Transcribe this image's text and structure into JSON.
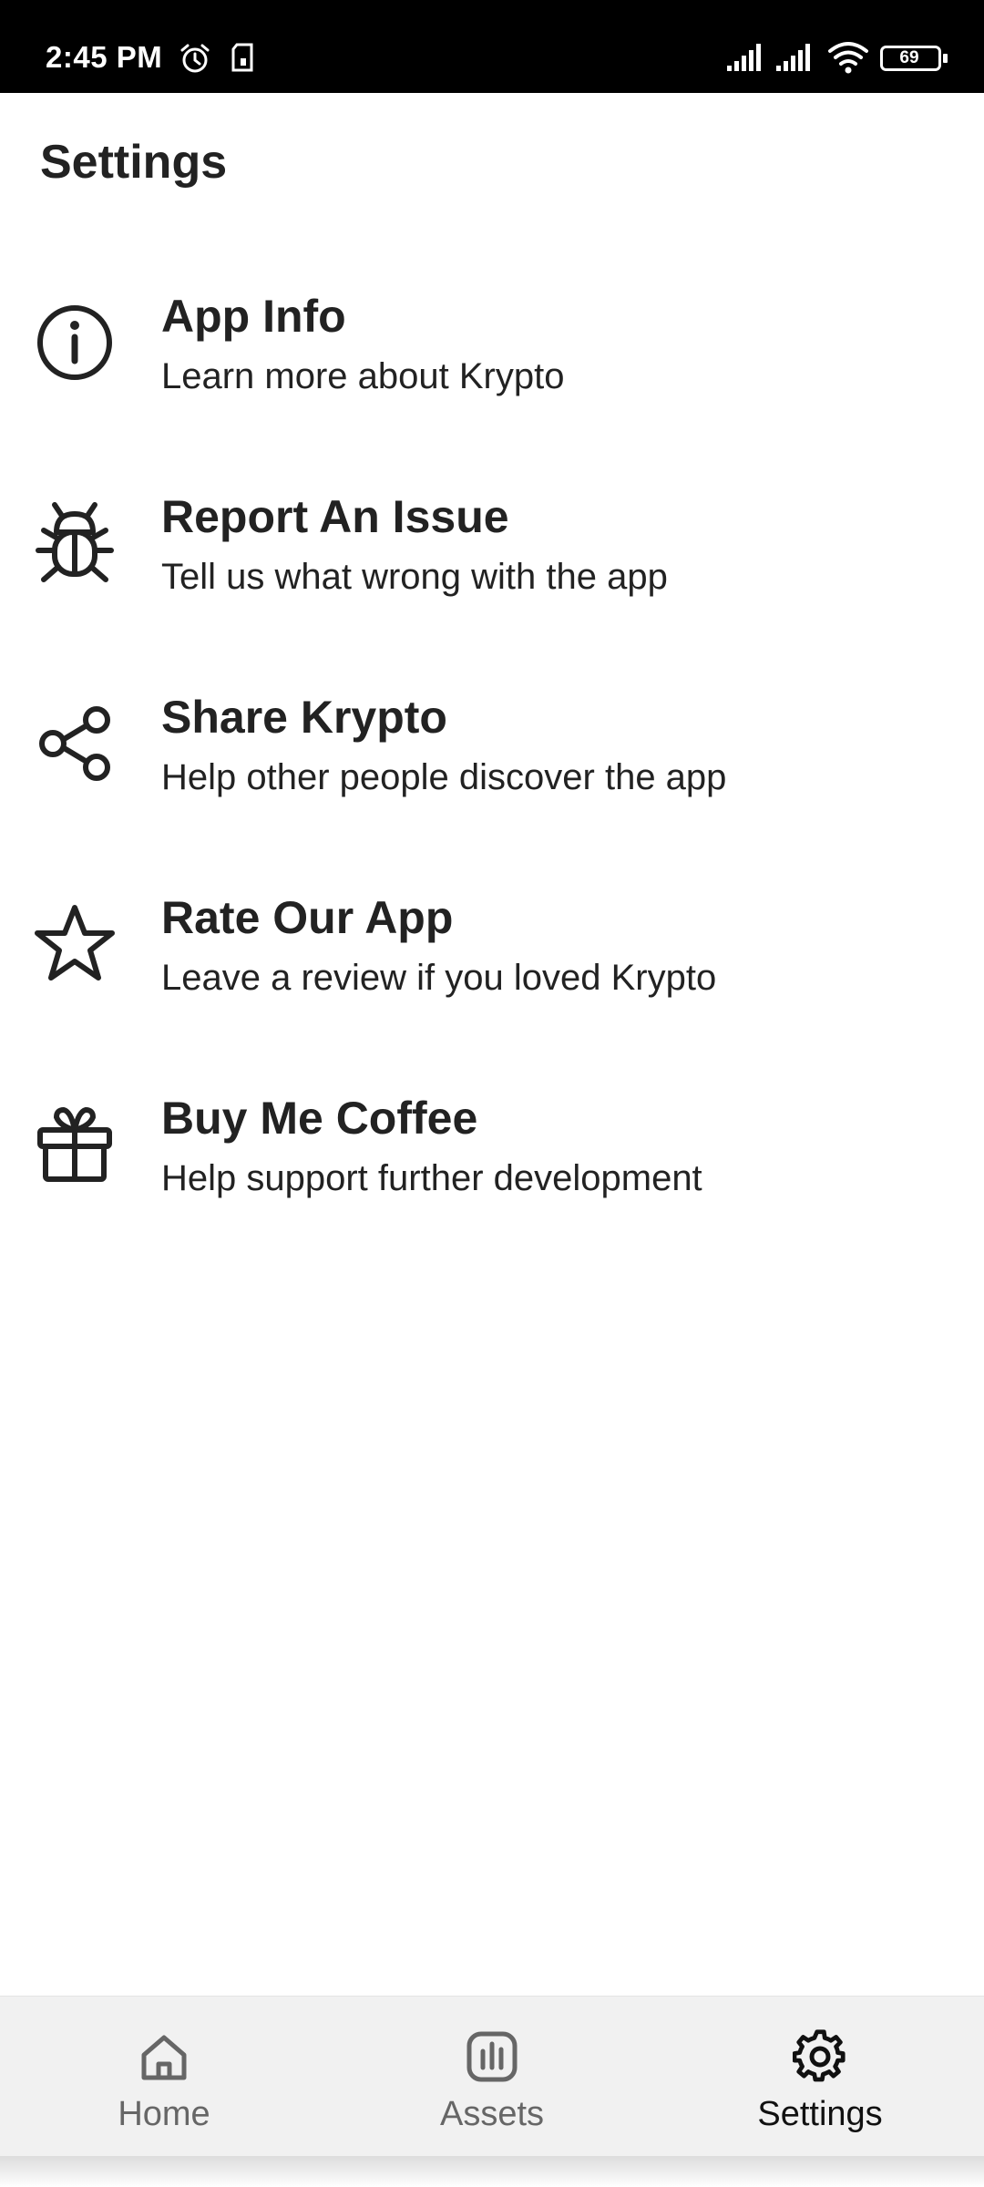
{
  "status_bar": {
    "time": "2:45 PM",
    "battery": "69",
    "icons": [
      "alarm-icon",
      "sd-card-icon",
      "signal-icon",
      "signal-icon",
      "wifi-icon",
      "battery-icon"
    ]
  },
  "header": {
    "title": "Settings"
  },
  "settings_items": [
    {
      "icon": "info-icon",
      "title": "App Info",
      "subtitle": "Learn more about Krypto"
    },
    {
      "icon": "bug-icon",
      "title": "Report An Issue",
      "subtitle": "Tell us what wrong with the app"
    },
    {
      "icon": "share-icon",
      "title": "Share Krypto",
      "subtitle": "Help other people discover the app"
    },
    {
      "icon": "star-icon",
      "title": "Rate Our App",
      "subtitle": "Leave a review if you loved Krypto"
    },
    {
      "icon": "gift-icon",
      "title": "Buy Me Coffee",
      "subtitle": "Help support further development"
    }
  ],
  "bottom_nav": {
    "active": "Settings",
    "items": [
      {
        "icon": "home-icon",
        "label": "Home"
      },
      {
        "icon": "assets-icon",
        "label": "Assets"
      },
      {
        "icon": "gear-icon",
        "label": "Settings"
      }
    ]
  }
}
